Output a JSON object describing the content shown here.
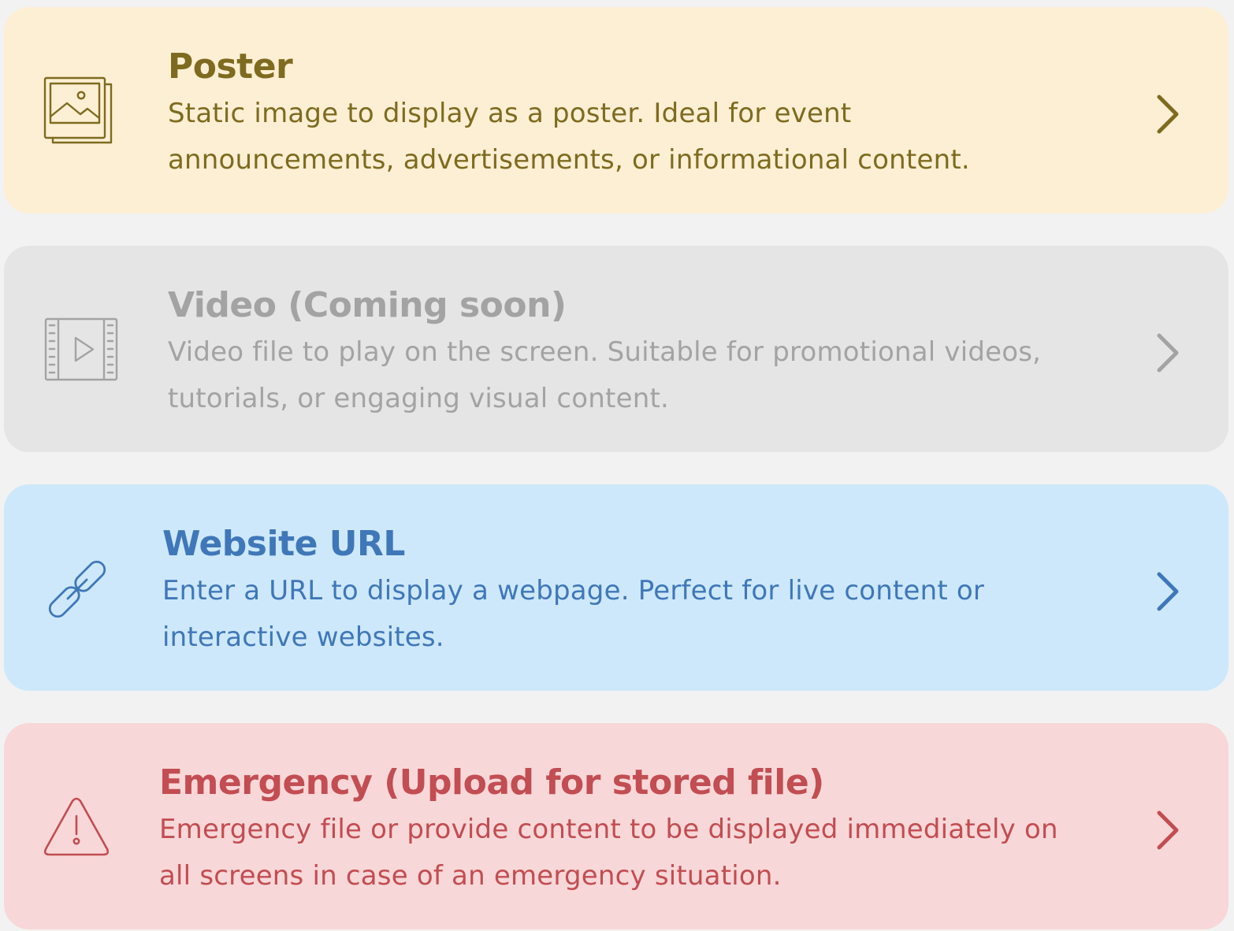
{
  "cards": [
    {
      "id": "poster",
      "title": "Poster",
      "description": "Static image to display as a poster. Ideal for event announcements, advertisements, or informational content.",
      "icon": "image-gallery-icon",
      "disabled": false
    },
    {
      "id": "video",
      "title": "Video (Coming soon)",
      "description": "Video file to play on the screen. Suitable for promotional videos, tutorials, or engaging visual content.",
      "icon": "film-play-icon",
      "disabled": true
    },
    {
      "id": "website",
      "title": "Website URL",
      "description": "Enter a URL to display a webpage. Perfect for live content or interactive websites.",
      "icon": "link-icon",
      "disabled": false
    },
    {
      "id": "emergency",
      "title": "Emergency (Upload for stored file)",
      "description": "Emergency file or provide content to be displayed immediately on all screens in case of an emergency situation.",
      "icon": "warning-triangle-icon",
      "disabled": false
    }
  ],
  "colors": {
    "poster_bg": "#fdefd4",
    "poster_fg": "#7e6b1f",
    "video_bg": "#e5e5e5",
    "video_fg": "#a3a3a3",
    "website_bg": "#cde8fa",
    "website_fg": "#3f77b8",
    "emergency_bg": "#f8d7d8",
    "emergency_fg": "#c24d52",
    "page_bg": "#f2f2f2"
  }
}
